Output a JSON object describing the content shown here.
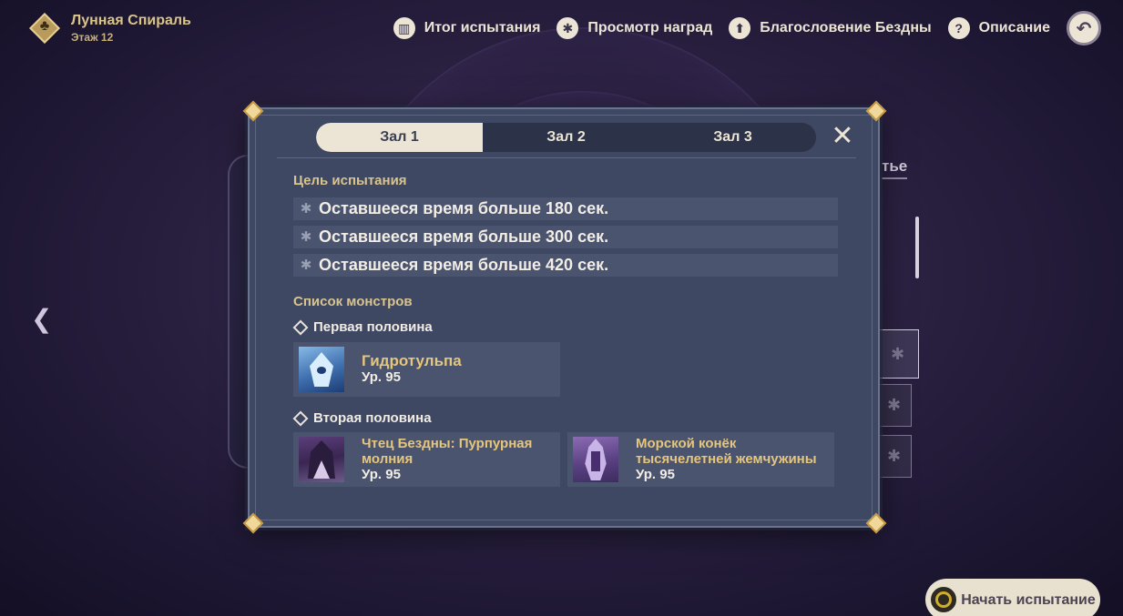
{
  "header": {
    "title": "Лунная Спираль",
    "floor": "Этаж 12"
  },
  "nav": [
    {
      "icon": "book-icon",
      "glyph": "▥",
      "label": "Итог испытания"
    },
    {
      "icon": "star-badge-icon",
      "glyph": "✱",
      "label": "Просмотр наград"
    },
    {
      "icon": "upgrade-arrow-icon",
      "glyph": "⬆",
      "label": "Благословение Бездны"
    },
    {
      "icon": "help-icon",
      "glyph": "?",
      "label": "Описание"
    }
  ],
  "back_icon": "↶",
  "background": {
    "peek_text": "тье"
  },
  "tabs": [
    {
      "label": "Зал 1",
      "active": true
    },
    {
      "label": "Зал 2",
      "active": false
    },
    {
      "label": "Зал 3",
      "active": false
    }
  ],
  "close_glyph": "✕",
  "goals": {
    "title": "Цель испытания",
    "items": [
      "Оставшееся время больше 180 сек.",
      "Оставшееся время больше 300 сек.",
      "Оставшееся время больше 420 сек."
    ]
  },
  "monsters": {
    "title": "Список монстров",
    "first_half": {
      "title": "Первая половина",
      "list": [
        {
          "name": "Гидротульпа",
          "level": "Ур. 95"
        }
      ]
    },
    "second_half": {
      "title": "Вторая половина",
      "list": [
        {
          "name": "Чтец Бездны: Пурпурная молния",
          "level": "Ур. 95"
        },
        {
          "name": "Морской конёк тысячелетней жемчужины",
          "level": "Ур. 95"
        }
      ]
    }
  },
  "start_button": "Начать испытание"
}
